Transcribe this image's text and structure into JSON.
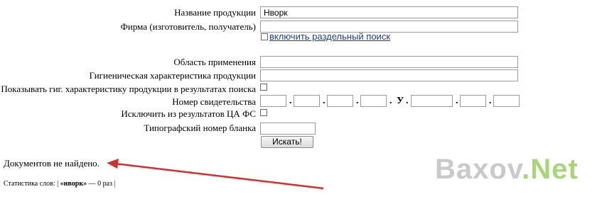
{
  "form": {
    "product_name": {
      "label": "Название продукции",
      "value": "Нворк"
    },
    "firm": {
      "label": "Фирма (изготовитель, получатель)",
      "value": ""
    },
    "separate_search_label": "включить раздельный поиск",
    "scope": {
      "label": "Область применения",
      "value": ""
    },
    "hygiene": {
      "label": "Гигиеническая характеристика продукции",
      "value": ""
    },
    "show_hygiene_label": "Показывать гиг. характеристику продукции в результатах поиска",
    "certificate_number": {
      "label": "Номер свидетельства",
      "separators": [
        ".",
        ".",
        ".",
        ".",
        "У",
        ".",
        ".",
        "."
      ]
    },
    "exclude_label": "Исключить из результатов ЦА ФС",
    "blank_number_label": "Типографский номер бланка",
    "search_button": "Искать!"
  },
  "results": {
    "not_found": "Документов не найдено.",
    "stats_label": "Статистика слов: |",
    "stats_word": "«нворк»",
    "stats_count": "— 0 раз |"
  },
  "watermark": {
    "part1": "Baxov",
    "part2": ".Net",
    "color1": "#c9c9c9",
    "color2": "#a8d57a"
  },
  "annotation": {
    "arrow_color": "#d0312d"
  }
}
